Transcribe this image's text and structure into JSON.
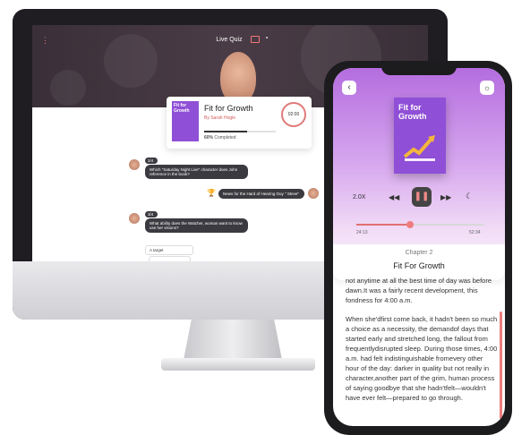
{
  "quiz": {
    "title": "Live Quiz",
    "timer": "02:00",
    "card": {
      "book_label": "Fit for Growth",
      "title": "Fit for Growth",
      "author": "By Sarah Hogle",
      "progress_value": "60%",
      "progress_label": "Completed",
      "progress": 0.6
    },
    "messages": [
      {
        "tag": "2/4",
        "text": "Which \"Saturday Night Live\" character does John reference in the book?"
      },
      {
        "text": "News for the Hard of Hearing Guy \" Steve\""
      },
      {
        "tag": "3/4",
        "text": "What ability does the Watcher, woman want to know use her visions?"
      }
    ],
    "option": "A target"
  },
  "reader": {
    "book": {
      "title": "Fit for Growth"
    },
    "speed": "2.0X",
    "elapsed": "24:13",
    "total": "52:34",
    "seek_progress": 0.42,
    "chapter": "Chapter 2",
    "chapter_title": "Fit For Growth",
    "paragraphs": [
      "not anytime at all the best time of day was before dawn.It was a fairly recent development, this fondness for 4:00 a.m.",
      "When she'dfirst come back, it hadn't been so much a choice as a necessity, the demandof days that started early and stretched long, the fallout from frequentlydisrupted sleep. During those times, 4:00 a.m. had felt indistinguishable fromevery other hour of the day: darker in quality but not really in character,another part of the grim, human process of saying goodbye that she hadn'tfelt—wouldn't have ever felt—prepared to go through."
    ]
  },
  "icons": [
    "back-icon",
    "bulb-icon",
    "rewind-icon",
    "pause-icon",
    "forward-icon",
    "moon-icon",
    "trophy-icon",
    "menu-icon",
    "camera-icon",
    "bell-icon"
  ]
}
